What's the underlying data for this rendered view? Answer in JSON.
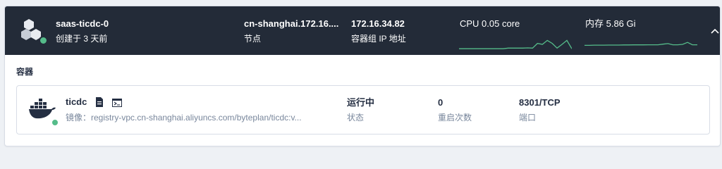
{
  "pod": {
    "name": "saas-ticdc-0",
    "created": "创建于 3 天前",
    "node": {
      "value": "cn-shanghai.172.16....",
      "label": "节点"
    },
    "pod_ip": {
      "value": "172.16.34.82",
      "label": "容器组 IP 地址"
    },
    "cpu": {
      "text": "CPU 0.05 core",
      "series": [
        0.6,
        0.6,
        0.6,
        0.6,
        0.6,
        0.6,
        0.6,
        0.6,
        0.6,
        0.6,
        1.2,
        1.2,
        1.2,
        1.2,
        1.4,
        1.2,
        6,
        5,
        9,
        6,
        1.2,
        5,
        9,
        0.6
      ]
    },
    "memory": {
      "text": "内存 5.86 Gi",
      "series": [
        4,
        4,
        4.2,
        4.2,
        4.2,
        4.3,
        4.3,
        4.3,
        4.4,
        4.4,
        4.5,
        4.5,
        4.5,
        4.6,
        4.6,
        4.6,
        5.2,
        5.8,
        4.6,
        4.6,
        5,
        7,
        4.6,
        4.6
      ]
    },
    "colors": {
      "header_bg": "#232b38",
      "status_ok": "#55bc8a",
      "sparkline": "#55bc8a"
    }
  },
  "section": {
    "title": "容器"
  },
  "container": {
    "name": "ticdc",
    "image": "镜像：registry-vpc.cn-shanghai.aliyuncs.com/byteplan/ticdc:v...",
    "status": {
      "value": "运行中",
      "label": "状态"
    },
    "restarts": {
      "value": "0",
      "label": "重启次数"
    },
    "port": {
      "value": "8301/TCP",
      "label": "端口"
    }
  },
  "icons": [
    "pod-icon",
    "docker-icon",
    "document-icon",
    "terminal-icon",
    "chevron-up-icon"
  ]
}
